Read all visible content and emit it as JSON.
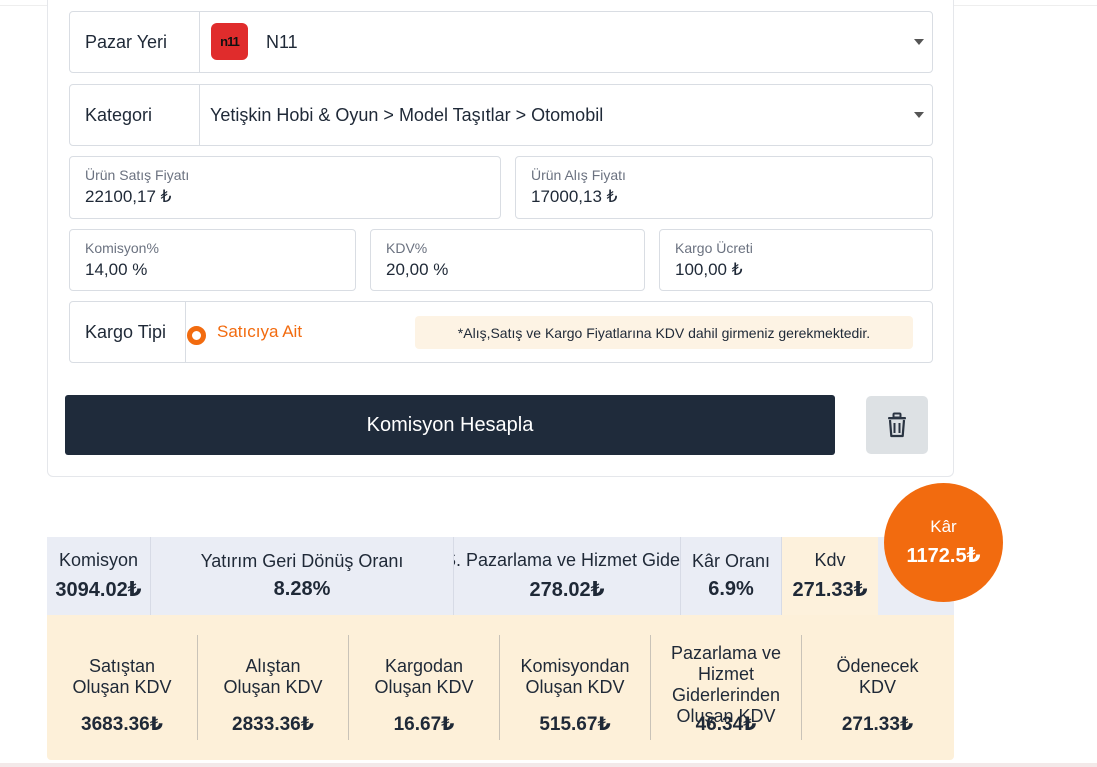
{
  "form": {
    "marketplace": {
      "label": "Pazar Yeri",
      "value": "N11",
      "logo_text": "n11"
    },
    "category": {
      "label": "Kategori",
      "value": "Yetişkin Hobi & Oyun > Model Taşıtlar > Otomobil"
    },
    "sale_price": {
      "label": "Ürün Satış Fiyatı",
      "value": "22100,17 ₺"
    },
    "purchase_price": {
      "label": "Ürün Alış Fiyatı",
      "value": "17000,13 ₺"
    },
    "commission": {
      "label": "Komisyon%",
      "value": "14,00 %"
    },
    "vat": {
      "label": "KDV%",
      "value": "20,00 %"
    },
    "shipping": {
      "label": "Kargo Ücreti",
      "value": "100,00 ₺"
    },
    "shipping_type": {
      "label": "Kargo Tipi",
      "option": "Satıcıya Ait"
    },
    "notice": "*Alış,Satış ve Kargo Fiyatlarına KDV dahil girmeniz gerekmektedir.",
    "calculate_label": "Komisyon Hesapla"
  },
  "profit": {
    "label": "Kâr",
    "value": "1172.5₺"
  },
  "summary": [
    {
      "label": "Komisyon",
      "value": "3094.02₺"
    },
    {
      "label": "Yatırım Geri Dönüş Oranı",
      "value": "8.28%"
    },
    {
      "label": "S. Pazarlama ve Hizmet Gideri",
      "value": "278.02₺"
    },
    {
      "label": "Kâr Oranı",
      "value": "6.9%"
    },
    {
      "label": "Kdv",
      "value": "271.33₺"
    }
  ],
  "kdv_breakdown": [
    {
      "label": "Satıştan Oluşan KDV",
      "value": "3683.36₺"
    },
    {
      "label": "Alıştan Oluşan KDV",
      "value": "2833.36₺"
    },
    {
      "label": "Kargodan Oluşan KDV",
      "value": "16.67₺"
    },
    {
      "label": "Komisyondan Oluşan KDV",
      "value": "515.67₺"
    },
    {
      "label": "Pazarlama ve Hizmet Giderlerinden Oluşan KDV",
      "value": "46.34₺"
    },
    {
      "label": "Ödenecek KDV",
      "value": "271.33₺"
    }
  ],
  "colors": {
    "accent": "#f26b0f",
    "button_dark": "#1f2b3b",
    "summary_bg": "#eaedf5",
    "kdv_bg": "#fdf0d9"
  },
  "icons": {
    "trash": "trash-icon"
  }
}
